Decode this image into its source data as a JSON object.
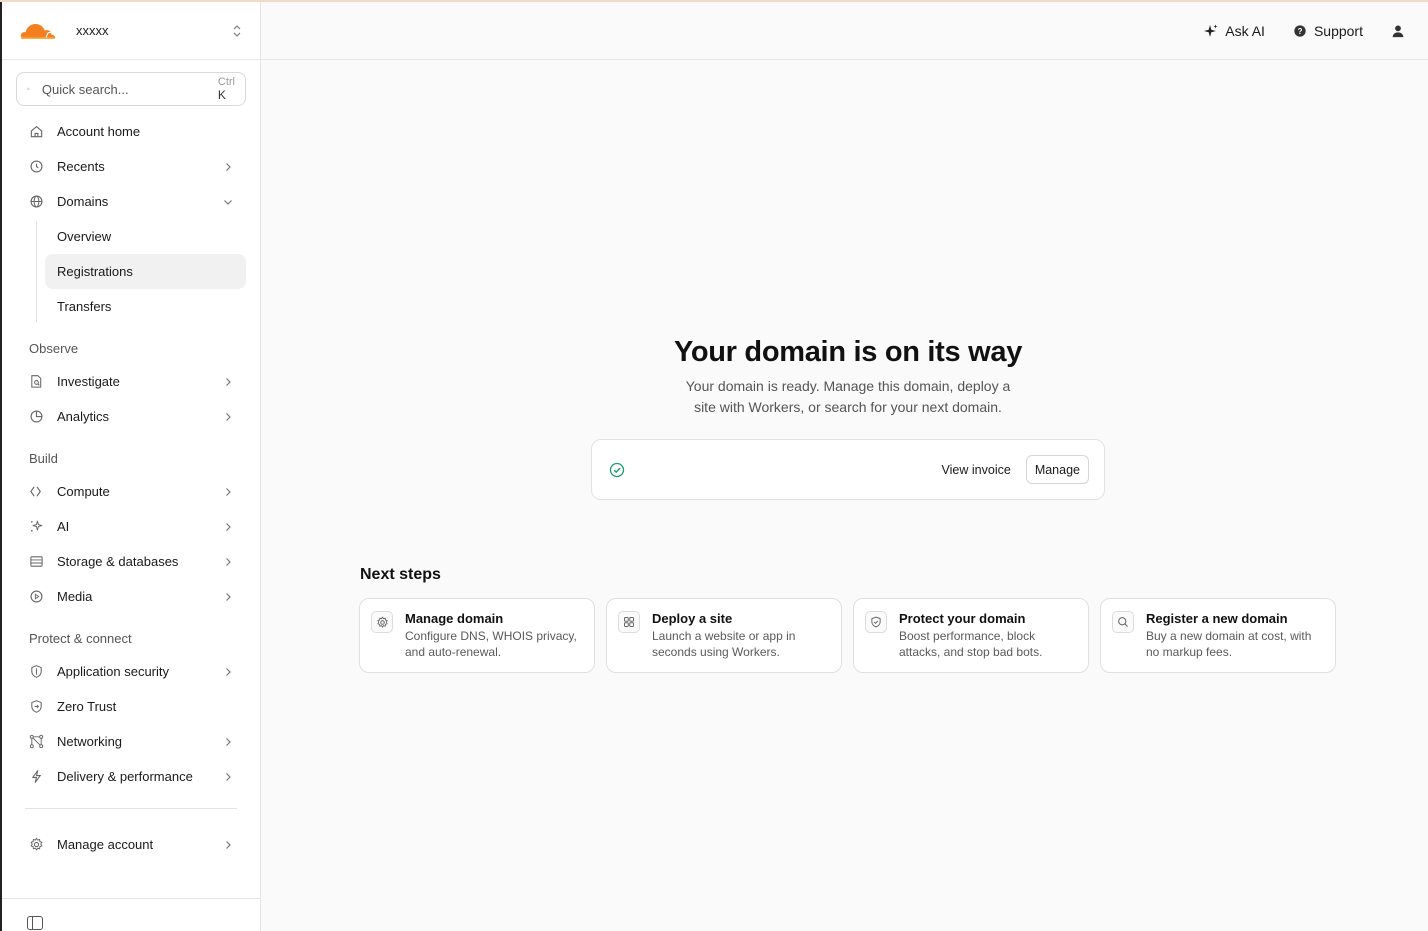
{
  "account": {
    "name": "xxxxx",
    "logo_icon": "cloudflare-logo",
    "brand_color": "#f38020"
  },
  "search": {
    "placeholder": "Quick search...",
    "shortcut_ctrl": "Ctrl",
    "shortcut_key": "K"
  },
  "nav": {
    "account_home": "Account home",
    "recents": "Recents",
    "domains": "Domains",
    "domains_sub": {
      "overview": "Overview",
      "registrations": "Registrations",
      "transfers": "Transfers"
    },
    "observe_label": "Observe",
    "investigate": "Investigate",
    "analytics": "Analytics",
    "build_label": "Build",
    "compute": "Compute",
    "ai": "AI",
    "storage": "Storage & databases",
    "media": "Media",
    "protect_label": "Protect & connect",
    "app_security": "Application security",
    "zero_trust": "Zero Trust",
    "networking": "Networking",
    "delivery": "Delivery & performance",
    "manage_account": "Manage account"
  },
  "header": {
    "ask_ai": "Ask AI",
    "support": "Support"
  },
  "hero": {
    "title": "Your domain is on its way",
    "subtitle": "Your domain is ready. Manage this domain, deploy a site with Workers, or search for your next domain."
  },
  "status": {
    "view_invoice": "View invoice",
    "manage": "Manage",
    "success_color": "#1a9e63"
  },
  "next_steps": {
    "title": "Next steps",
    "cards": [
      {
        "title": "Manage domain",
        "desc": "Configure DNS, WHOIS privacy, and auto-renewal.",
        "icon": "gear-icon"
      },
      {
        "title": "Deploy a site",
        "desc": "Launch a website or app in seconds using Workers.",
        "icon": "grid-icon"
      },
      {
        "title": "Protect your domain",
        "desc": "Boost performance, block attacks, and stop bad bots.",
        "icon": "shield-icon"
      },
      {
        "title": "Register a new domain",
        "desc": "Buy a new domain at cost, with no markup fees.",
        "icon": "search-icon"
      }
    ]
  }
}
